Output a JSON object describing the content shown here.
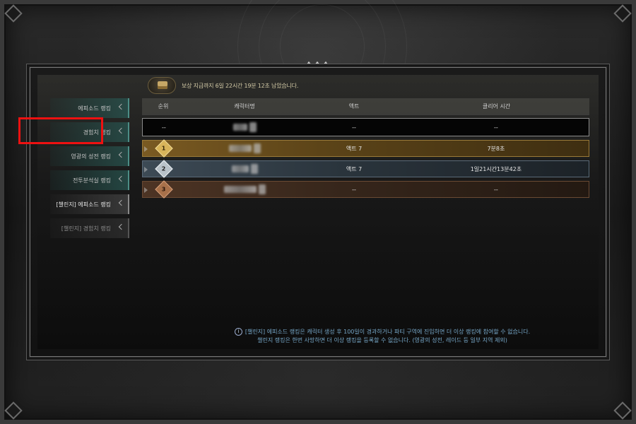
{
  "reward_notice": "보상 지급까지 6일 22시간 19분 12초 남았습니다.",
  "sidebar": {
    "items": [
      {
        "label": "에피소드 랭킹",
        "state": "normal"
      },
      {
        "label": "경험치 랭킹",
        "state": "normal"
      },
      {
        "label": "영광의 성전 랭킹",
        "state": "normal"
      },
      {
        "label": "전투분석실 랭킹",
        "state": "normal"
      },
      {
        "label": "[챌린지] 에피소드 랭킹",
        "state": "selected"
      },
      {
        "label": "[챌린지] 경험치 랭킹",
        "state": "dim"
      }
    ]
  },
  "table": {
    "headers": {
      "rank": "순위",
      "character": "캐릭터명",
      "act": "액트",
      "clear_time": "클리어 시간"
    },
    "my_row": {
      "rank": "--",
      "act": "--",
      "clear_time": "--"
    },
    "rows": [
      {
        "rank": "1",
        "act": "액트 7",
        "clear_time": "7분8초"
      },
      {
        "rank": "2",
        "act": "액트 7",
        "clear_time": "1일21시간13분42초"
      },
      {
        "rank": "3",
        "act": "--",
        "clear_time": "--"
      }
    ]
  },
  "notice": {
    "line1": "[챌린지] 에피소드 랭킹은 캐릭터 생성 후 100일이 경과하거나 파티 구역에 진입하면 더 이상 랭킹에 참여할 수 없습니다.",
    "line2": "챌린지 랭킹은 한번 사망하면 더 이상 랭킹을 등록할 수 없습니다. (영광의 성전, 레이드 등 일부 지역 제외)"
  },
  "colors": {
    "accent_teal": "#4c8d86",
    "highlight_red": "#e11111",
    "notice_blue": "#76a7c8"
  }
}
